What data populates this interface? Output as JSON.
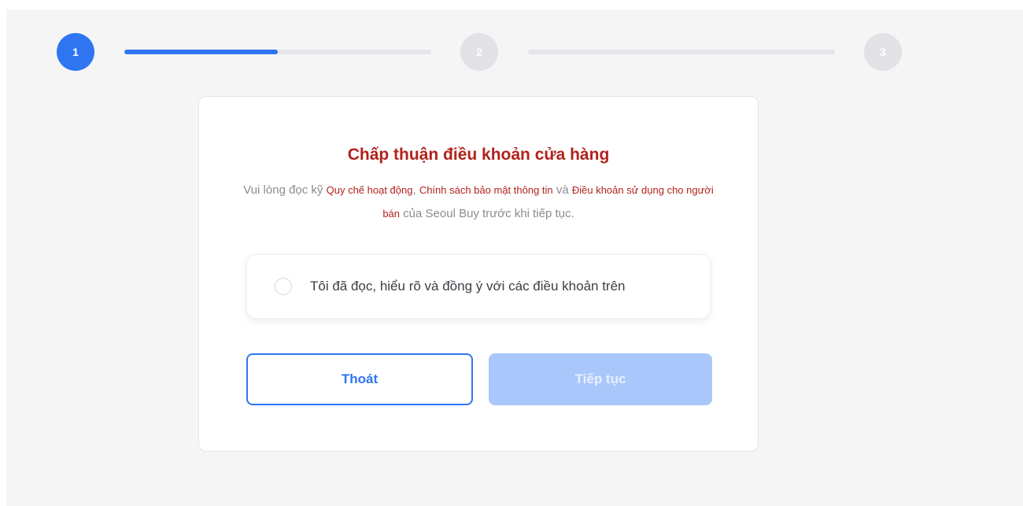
{
  "stepper": {
    "steps": [
      {
        "label": "1",
        "state": "active"
      },
      {
        "label": "2",
        "state": "inactive"
      },
      {
        "label": "3",
        "state": "inactive"
      }
    ],
    "progress": [
      0.5,
      0
    ]
  },
  "card": {
    "title": "Chấp thuận điều khoản cửa hàng",
    "desc": {
      "prefix": "Vui lòng đọc kỹ ",
      "link1": "Quy chế hoạt động",
      "sep1": ", ",
      "link2": "Chính sách bảo mật thông tin",
      "sep2": " và ",
      "link3": "Điều khoản sử dụng cho người bán",
      "suffix": " của Seoul Buy trước khi tiếp tục."
    },
    "agree_label": "Tôi đã đọc, hiểu rõ và đồng ý với các điều khoản trên",
    "agree_checked": false
  },
  "buttons": {
    "exit_label": "Thoát",
    "next_label": "Tiếp tục",
    "next_disabled": true
  },
  "colors": {
    "accent": "#2f75f2",
    "title_red": "#b1221c",
    "disabled_button": "#a9c7fa"
  }
}
